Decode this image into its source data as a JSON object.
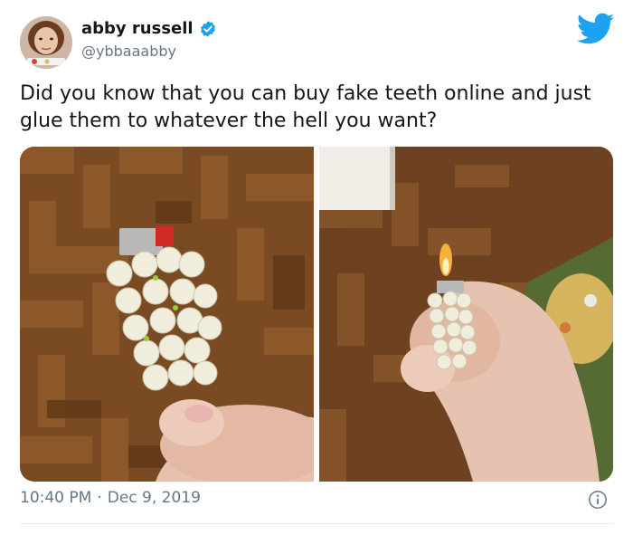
{
  "tweet": {
    "author_name": "abby russell",
    "author_handle": "@ybbaaabby",
    "text": "Did you know that you can buy fake teeth online and just glue them to whatever the hell you want?",
    "time": "10:40 PM",
    "separator": "·",
    "date": "Dec 9, 2019"
  },
  "icons": {
    "verified": "verified-badge-icon",
    "brand": "twitter-bird-icon",
    "info": "info-icon"
  },
  "colors": {
    "brand_blue": "#1da1f2",
    "secondary_text": "#657786",
    "primary_text": "#14171a"
  }
}
